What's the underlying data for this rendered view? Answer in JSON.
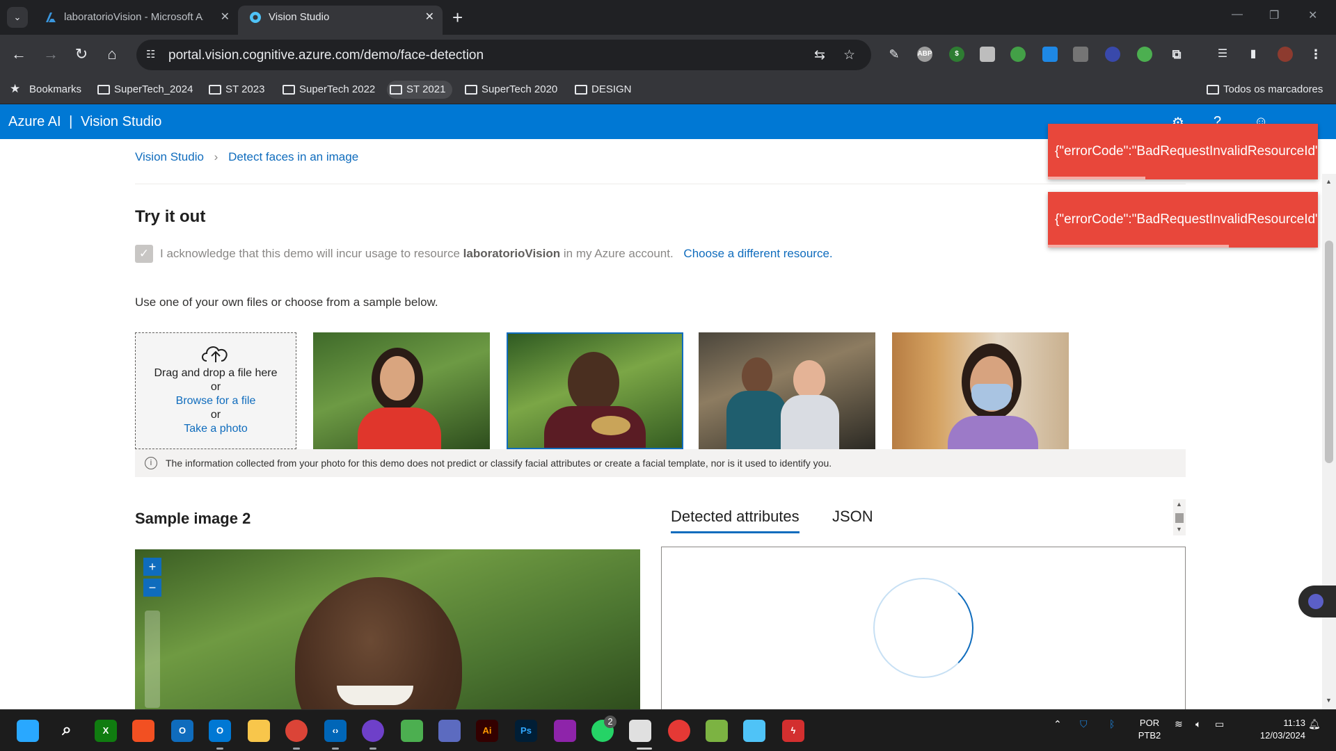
{
  "browser": {
    "tabs": [
      {
        "title": "laboratorioVision - Microsoft Az"
      },
      {
        "title": "Vision Studio"
      }
    ],
    "url": "portal.vision.cognitive.azure.com/demo/face-detection",
    "bookmarks_label": "Bookmarks",
    "bookmarks": [
      "SuperTech_2024",
      "ST 2023",
      "SuperTech 2022",
      "ST 2021",
      "SuperTech 2020",
      "DESIGN"
    ],
    "all_bookmarks": "Todos os marcadores",
    "extensions": [
      "ABP"
    ]
  },
  "app": {
    "brand": "Azure AI",
    "separator": "|",
    "product": "Vision Studio"
  },
  "breadcrumb": {
    "root": "Vision Studio",
    "current": "Detect faces in an image"
  },
  "tryit": {
    "heading": "Try it out",
    "ack_prefix": "I acknowledge that this demo will incur usage to resource",
    "resource": "laboratorioVision",
    "ack_suffix": "in my Azure account.",
    "change_link": "Choose a different resource.",
    "lead": "Use one of your own files or choose from a sample below."
  },
  "dropzone": {
    "drag": "Drag and drop a file here",
    "or1": "or",
    "browse": "Browse for a file",
    "or2": "or",
    "photo": "Take a photo"
  },
  "info_notice": "The information collected from your photo for this demo does not predict or classify facial attributes or create a facial template, nor is it used to identify you.",
  "sample": {
    "title": "Sample image 2",
    "tabs": [
      "Detected attributes",
      "JSON"
    ]
  },
  "zoom": {
    "in": "+",
    "out": "−"
  },
  "errors": [
    "{\"errorCode\":\"BadRequestInvalidResourceId\"",
    "{\"errorCode\":\"BadRequestInvalidResourceId\""
  ],
  "taskbar": {
    "whatsapp_badge": "2",
    "language": "POR",
    "layout": "PTB2",
    "time": "11:13",
    "date": "12/03/2024"
  }
}
